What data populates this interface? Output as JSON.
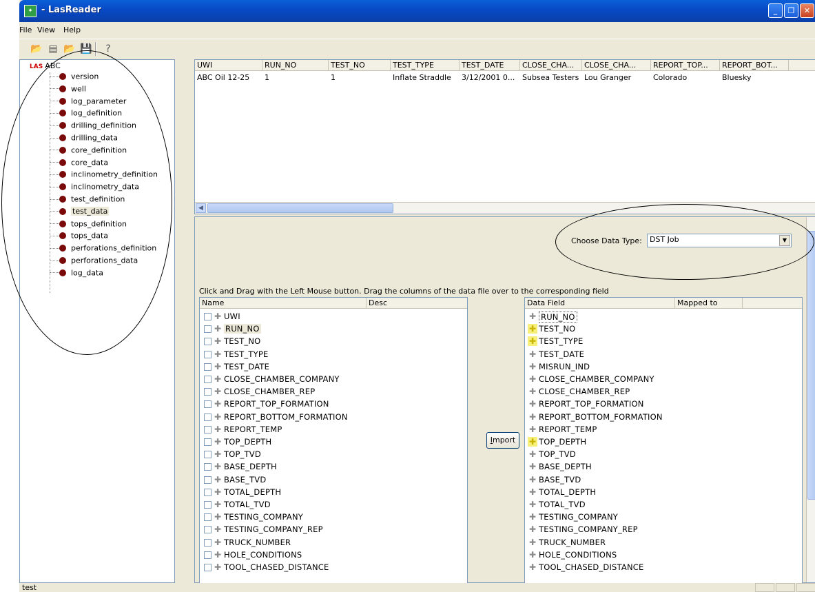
{
  "window": {
    "title": "- LasReader",
    "icon": "app-icon"
  },
  "menu": [
    "File",
    "View",
    "Help"
  ],
  "toolbar": {
    "icons": [
      "open-folder-icon",
      "las-file-icon",
      "open-file-icon",
      "save-icon",
      "help-icon"
    ]
  },
  "tree": {
    "root": "ABC",
    "root_icon_text": "LAS",
    "items": [
      "version",
      "well",
      "log_parameter",
      "log_definition",
      "drilling_definition",
      "drilling_data",
      "core_definition",
      "core_data",
      "inclinometry_definition",
      "inclinometry_data",
      "test_definition",
      "test_data",
      "tops_definition",
      "tops_data",
      "perforations_definition",
      "perforations_data",
      "log_data"
    ],
    "selected": "test_data"
  },
  "grid": {
    "columns": [
      "UWI",
      "RUN_NO",
      "TEST_NO",
      "TEST_TYPE",
      "TEST_DATE",
      "CLOSE_CHA...",
      "CLOSE_CHA...",
      "REPORT_TOP...",
      "REPORT_BOT..."
    ],
    "rows": [
      [
        "ABC Oil 12-25",
        "1",
        "1",
        "Inflate Straddle",
        "3/12/2001 0...",
        "Subsea Testers",
        "Lou Granger",
        "Colorado",
        "Bluesky"
      ]
    ]
  },
  "choose": {
    "label": "Choose Data Type:",
    "value": "DST Job"
  },
  "instructions": "Click and Drag with the Left Mouse button. Drag the columns of the data file over to the corresponding field",
  "left_list": {
    "headers": [
      "Name",
      "Desc"
    ],
    "items": [
      "UWI",
      "RUN_NO",
      "TEST_NO",
      "TEST_TYPE",
      "TEST_DATE",
      "CLOSE_CHAMBER_COMPANY",
      "CLOSE_CHAMBER_REP",
      "REPORT_TOP_FORMATION",
      "REPORT_BOTTOM_FORMATION",
      "REPORT_TEMP",
      "TOP_DEPTH",
      "TOP_TVD",
      "BASE_DEPTH",
      "BASE_TVD",
      "TOTAL_DEPTH",
      "TOTAL_TVD",
      "TESTING_COMPANY",
      "TESTING_COMPANY_REP",
      "TRUCK_NUMBER",
      "HOLE_CONDITIONS",
      "TOOL_CHASED_DISTANCE"
    ]
  },
  "import_button": {
    "label": "Import",
    "mnemonic": "I",
    "rest": "mport"
  },
  "right_list": {
    "headers": [
      "Data Field",
      "Mapped to"
    ],
    "items": [
      "RUN_NO",
      "TEST_NO",
      "TEST_TYPE",
      "TEST_DATE",
      "MISRUN_IND",
      "CLOSE_CHAMBER_COMPANY",
      "CLOSE_CHAMBER_REP",
      "REPORT_TOP_FORMATION",
      "REPORT_BOTTOM_FORMATION",
      "REPORT_TEMP",
      "TOP_DEPTH",
      "TOP_TVD",
      "BASE_DEPTH",
      "BASE_TVD",
      "TOTAL_DEPTH",
      "TOTAL_TVD",
      "TESTING_COMPANY",
      "TESTING_COMPANY_REP",
      "TRUCK_NUMBER",
      "HOLE_CONDITIONS",
      "TOOL_CHASED_DISTANCE"
    ],
    "highlighted": [
      "TEST_NO",
      "TEST_TYPE",
      "TOP_DEPTH"
    ]
  },
  "status": {
    "text": "test"
  },
  "colors": {
    "titlebar": "#0a5fd8",
    "tree_dot": "#7a0a0a",
    "highlight_icon": "#f6ef7a"
  }
}
